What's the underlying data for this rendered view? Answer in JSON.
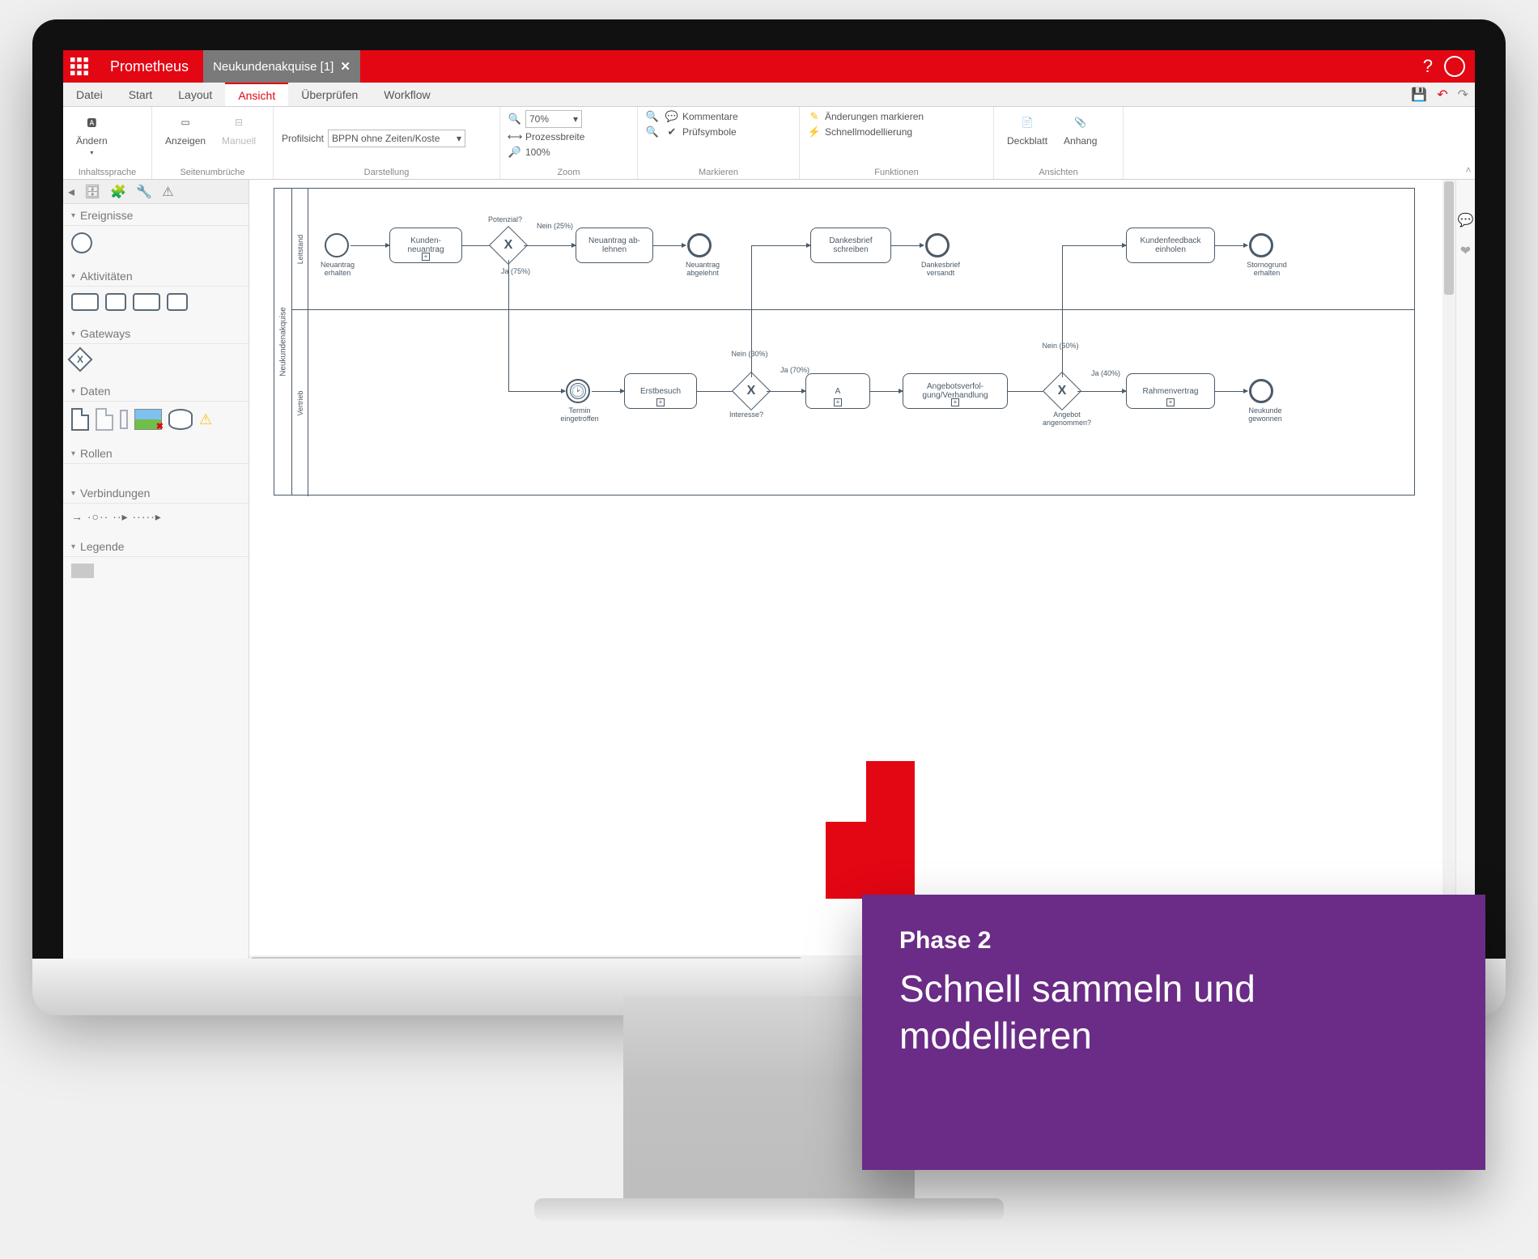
{
  "app": {
    "name": "Prometheus"
  },
  "titlebar": {
    "tab_label": "Neukundenakquise [1]",
    "help": "?"
  },
  "menu": {
    "items": [
      "Datei",
      "Start",
      "Layout",
      "Ansicht",
      "Überprüfen",
      "Workflow"
    ],
    "active_index": 3
  },
  "ribbon": {
    "groups": {
      "inhaltssprache": {
        "label": "Inhaltssprache",
        "btn_aendern": "Ändern",
        "btn_anzeigen": "Anzeigen",
        "btn_manuell": "Manuell"
      },
      "seitenumbrueche": {
        "label": "Seitenumbrüche"
      },
      "darstellung": {
        "label": "Darstellung",
        "profilsicht_label": "Profilsicht",
        "profilsicht_value": "BPPN ohne Zeiten/Koste"
      },
      "zoom": {
        "label": "Zoom",
        "zoom_value": "70%",
        "prozessbreite": "Prozessbreite",
        "hundert": "100%"
      },
      "markieren": {
        "label": "Markieren",
        "kommentare": "Kommentare",
        "pruefsymbole": "Prüfsymbole",
        "aenderungen": "Änderungen markieren",
        "schnellmodellierung": "Schnellmodellierung"
      },
      "funktionen": {
        "label": "Funktionen"
      },
      "ansichten": {
        "label": "Ansichten",
        "deckblatt": "Deckblatt",
        "anhang": "Anhang"
      }
    }
  },
  "palette": {
    "sections": {
      "ereignisse": "Ereignisse",
      "aktivitaeten": "Aktivitäten",
      "gateways": "Gateways",
      "daten": "Daten",
      "rollen": "Rollen",
      "verbindungen": "Verbindungen",
      "legende": "Legende"
    }
  },
  "diagram": {
    "pool": "Neukundenakquise",
    "lane1": "Leitstand",
    "lane2": "Vertrieb",
    "nodes": {
      "start": "Neuantrag erhalten",
      "task_kundenneuantrag": "Kunden-\nneuantrag",
      "gw_potenzial": "Potenzial?",
      "gw_potenzial_no": "Nein (25%)",
      "gw_potenzial_yes": "Ja (75%)",
      "task_ablehnen": "Neuantrag ab-\nlehnen",
      "end_abgelehnt": "Neuantrag abgelehnt",
      "task_dankesbrief": "Dankesbrief schreiben",
      "end_dankesbrief": "Dankesbrief versandt",
      "task_feedback": "Kundenfeedback einholen",
      "end_storno": "Stornogrund erhalten",
      "evt_termin": "Termin eingetroffen",
      "task_erstbesuch": "Erstbesuch",
      "gw_interesse": "Interesse?",
      "gw_interesse_no": "Nein (30%)",
      "gw_interesse_yes": "Ja (70%)",
      "task_a": "A",
      "task_verfolgung": "Angebotsverfol-\ngung/Verhandlung",
      "gw_angebot": "Angebot angenommen?",
      "gw_angebot_no": "Nein (60%)",
      "gw_angebot_yes": "Ja (40%)",
      "task_rahmen": "Rahmenvertrag",
      "end_neukunde": "Neukunde gewonnen"
    }
  },
  "promo": {
    "phase": "Phase 2",
    "headline": "Schnell sammeln und modellieren"
  },
  "right_rail": {
    "chat_tip": "💬",
    "activity_tip": "❤"
  }
}
